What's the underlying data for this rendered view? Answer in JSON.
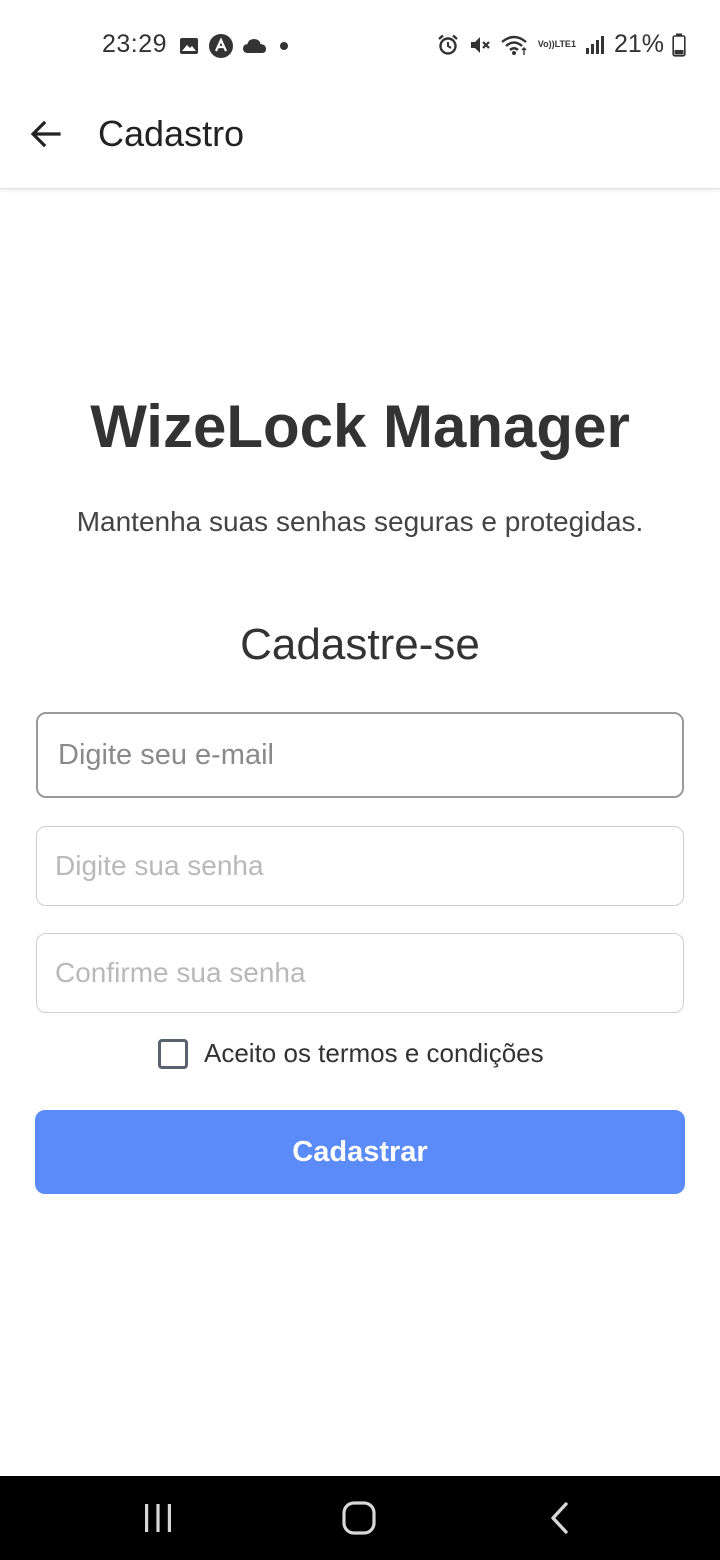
{
  "status_bar": {
    "time": "23:29",
    "battery": "21%",
    "volte_top": "Vo))",
    "volte_bottom": "LTE1",
    "left_icons": [
      "image-icon",
      "app-icon",
      "cloud-icon",
      "dot-icon"
    ],
    "right_icons": [
      "alarm-icon",
      "mute-icon",
      "wifi-icon",
      "volte-icon",
      "signal-icon",
      "battery-icon"
    ]
  },
  "app_bar": {
    "title": "Cadastro",
    "back_icon": "arrow-left-icon"
  },
  "main": {
    "app_title": "WizeLock Manager",
    "subtitle": "Mantenha suas senhas seguras e protegidas.",
    "section_title": "Cadastre-se",
    "email_placeholder": "Digite seu e-mail",
    "password_placeholder": "Digite sua senha",
    "confirm_placeholder": "Confirme sua senha",
    "terms_label": "Aceito os termos e condições",
    "terms_checked": false,
    "submit_label": "Cadastrar"
  },
  "colors": {
    "primary": "#5a8bf9",
    "text": "#333333",
    "nav_bar": "#000000"
  },
  "nav_bar": {
    "icons": [
      "recent-apps-icon",
      "home-icon",
      "back-icon"
    ]
  }
}
